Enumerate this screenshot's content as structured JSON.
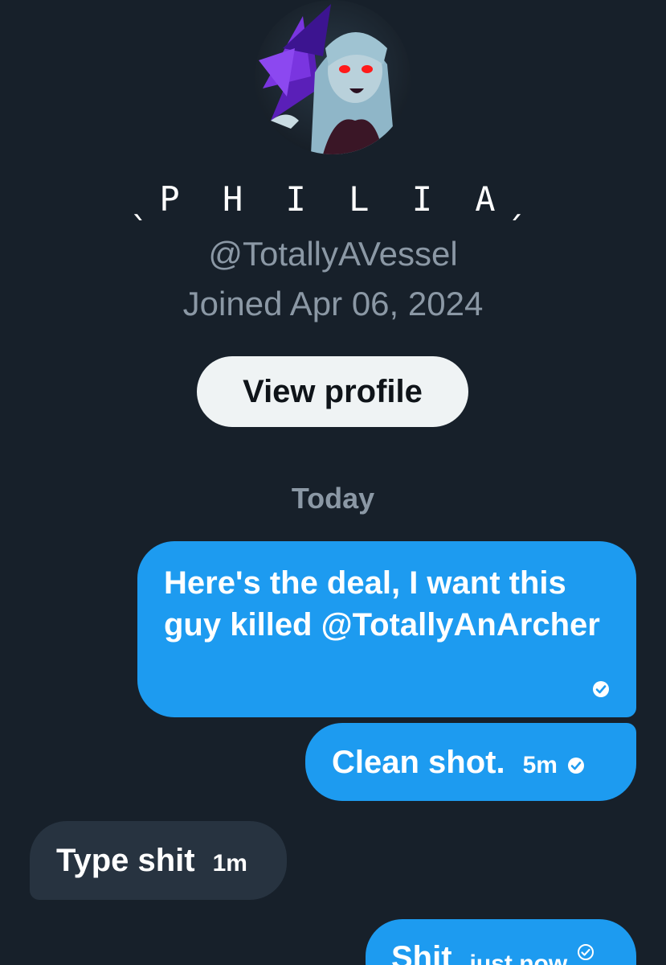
{
  "profile": {
    "display_name": "ˎP H I L I Aˏ",
    "handle": "@TotallyAVessel",
    "joined": "Joined Apr 06, 2024",
    "view_profile_label": "View profile"
  },
  "conversation": {
    "date_separator": "Today",
    "messages": [
      {
        "direction": "outgoing",
        "text": "Here's the deal, I want this guy killed @TotallyAnArcher",
        "time": "",
        "status_icon": "sent-check-icon"
      },
      {
        "direction": "outgoing",
        "text": "Clean shot.",
        "time": "5m",
        "status_icon": "sent-check-icon"
      },
      {
        "direction": "incoming",
        "text": "Type shit",
        "time": "1m"
      },
      {
        "direction": "outgoing",
        "text": "Shit",
        "time": "just now",
        "status_icon": "sent-check-icon"
      }
    ]
  },
  "colors": {
    "background": "#17202a",
    "outgoing_bubble": "#1d9bf0",
    "incoming_bubble": "#273340",
    "muted_text": "#8b98a5",
    "button_bg": "#eff3f4"
  }
}
